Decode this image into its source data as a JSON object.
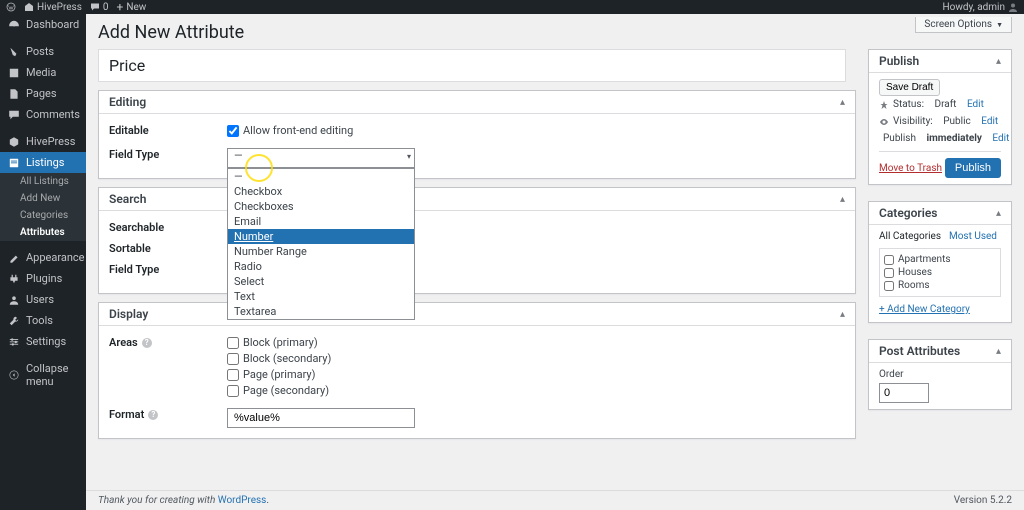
{
  "adminbar": {
    "site_name": "HivePress",
    "comments_count": "0",
    "new_label": "New",
    "howdy": "Howdy, admin"
  },
  "screen_options_label": "Screen Options",
  "sidebar_menu": {
    "dashboard": "Dashboard",
    "posts": "Posts",
    "media": "Media",
    "pages": "Pages",
    "comments": "Comments",
    "hivepress": "HivePress",
    "listings": "Listings",
    "appearance": "Appearance",
    "plugins": "Plugins",
    "users": "Users",
    "tools": "Tools",
    "settings": "Settings",
    "collapse": "Collapse menu"
  },
  "listings_submenu": {
    "all": "All Listings",
    "add_new": "Add New",
    "categories": "Categories",
    "attributes": "Attributes"
  },
  "page_title": "Add New Attribute",
  "title_value": "Price",
  "box_editing": {
    "heading": "Editing",
    "editable_label": "Editable",
    "allow_front_end": "Allow front-end editing",
    "field_type_label": "Field Type",
    "field_type_value": "—"
  },
  "dropdown_options": [
    "—",
    "Checkbox",
    "Checkboxes",
    "Email",
    "Number",
    "Number Range",
    "Radio",
    "Select",
    "Text",
    "Textarea"
  ],
  "dropdown_highlighted_index": 4,
  "box_search": {
    "heading": "Search",
    "searchable_label": "Searchable",
    "sortable_label": "Sortable",
    "field_type_label": "Field Type",
    "field_type_value": "—"
  },
  "box_display": {
    "heading": "Display",
    "areas_label": "Areas",
    "format_label": "Format",
    "format_value": "%value%",
    "areas": [
      "Block (primary)",
      "Block (secondary)",
      "Page (primary)",
      "Page (secondary)"
    ]
  },
  "publish": {
    "heading": "Publish",
    "save_draft": "Save Draft",
    "status_label": "Status:",
    "status_value": "Draft",
    "visibility_label": "Visibility:",
    "visibility_value": "Public",
    "publish_label": "Publish",
    "publish_value": "immediately",
    "edit": "Edit",
    "move_to_trash": "Move to Trash",
    "publish_btn": "Publish"
  },
  "categories": {
    "heading": "Categories",
    "tab_all": "All Categories",
    "tab_most": "Most Used",
    "items": [
      "Apartments",
      "Houses",
      "Rooms"
    ],
    "add_new": "+ Add New Category"
  },
  "post_attributes": {
    "heading": "Post Attributes",
    "order_label": "Order",
    "order_value": "0"
  },
  "footer_thanks": "Thank you for creating with ",
  "footer_link": "WordPress",
  "footer_version": "Version 5.2.2"
}
